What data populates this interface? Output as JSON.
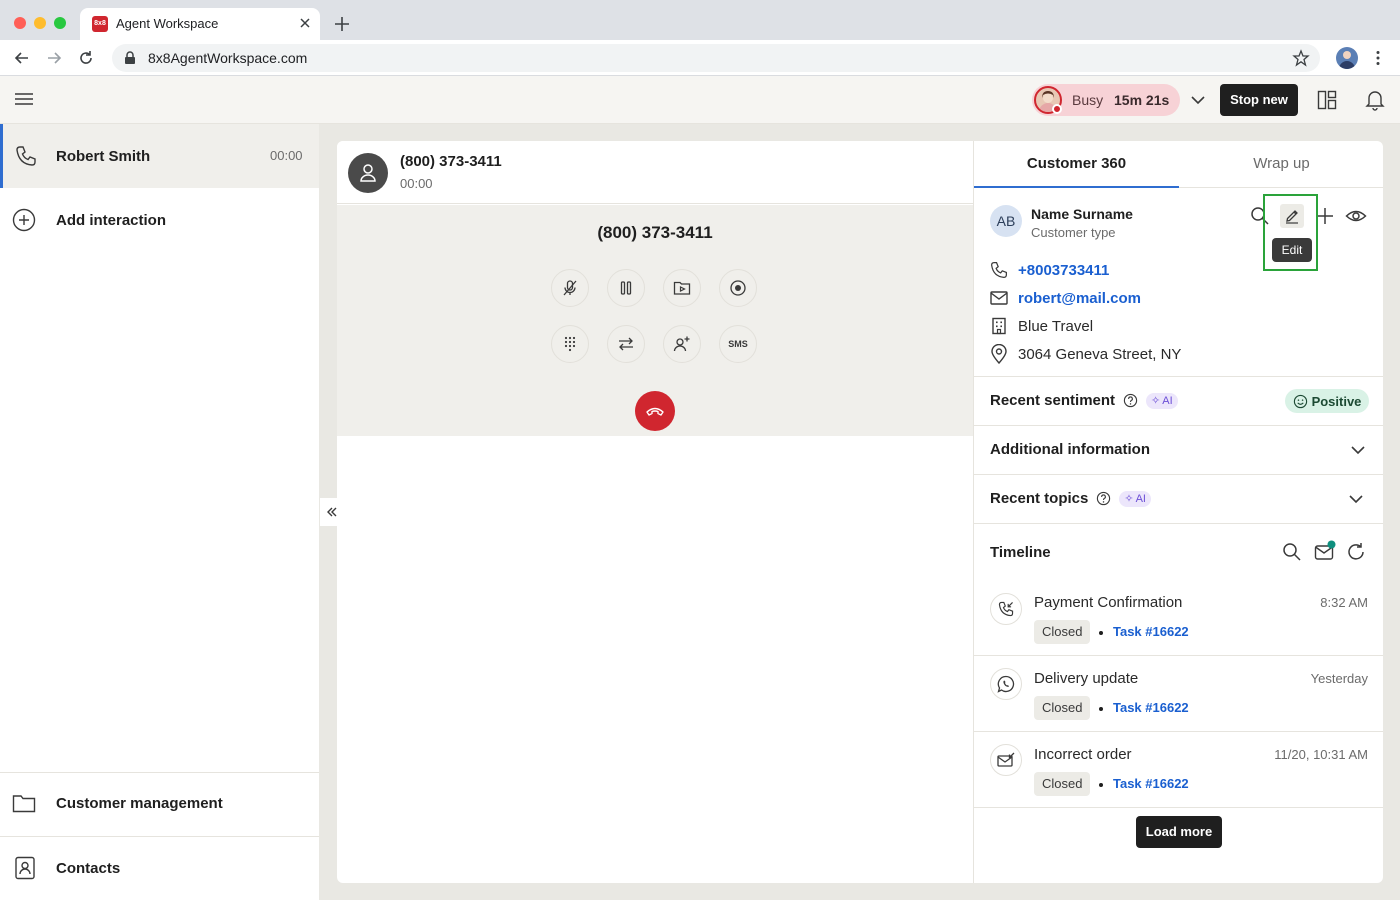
{
  "browser": {
    "tab_title": "Agent Workspace",
    "favicon_text": "8x8",
    "url": "8x8AgentWorkspace.com"
  },
  "header": {
    "status_label": "Busy",
    "status_timer": "15m 21s",
    "stop_button": "Stop new"
  },
  "sidebar": {
    "active_interaction": {
      "name": "Robert Smith",
      "time": "00:00"
    },
    "add_interaction": "Add interaction",
    "bottom_items": [
      {
        "label": "Customer management",
        "icon": "folder-icon"
      },
      {
        "label": "Contacts",
        "icon": "contacts-icon"
      }
    ]
  },
  "call": {
    "number": "(800) 373-3411",
    "elapsed": "00:00",
    "display_number": "(800) 373-3411",
    "sms_label": "SMS"
  },
  "customer360": {
    "tabs": [
      "Customer 360",
      "Wrap up"
    ],
    "initials": "AB",
    "name": "Name Surname",
    "type": "Customer type",
    "edit_tooltip": "Edit",
    "phone": "+8003733411",
    "email": "robert@mail.com",
    "company": "Blue Travel",
    "address": "3064 Geneva Street, NY",
    "recent_sentiment": "Recent sentiment",
    "ai_label": "AI",
    "sentiment_value": "Positive",
    "additional_info": "Additional information",
    "recent_topics": "Recent topics",
    "timeline_title": "Timeline",
    "timeline": [
      {
        "title": "Payment Confirmation",
        "time": "8:32 AM",
        "status": "Closed",
        "task": "Task #16622",
        "icon": "incoming-call-icon"
      },
      {
        "title": "Delivery update",
        "time": "Yesterday",
        "status": "Closed",
        "task": "Task #16622",
        "icon": "whatsapp-icon"
      },
      {
        "title": "Incorrect order",
        "time": "11/20, 10:31 AM",
        "status": "Closed",
        "task": "Task #16622",
        "icon": "incoming-email-icon"
      }
    ],
    "load_more": "Load more"
  },
  "colors": {
    "accent_blue": "#2f6dd0",
    "link_blue": "#1a5fd0",
    "danger_red": "#d0262f",
    "highlight_green": "#2aa33a"
  }
}
